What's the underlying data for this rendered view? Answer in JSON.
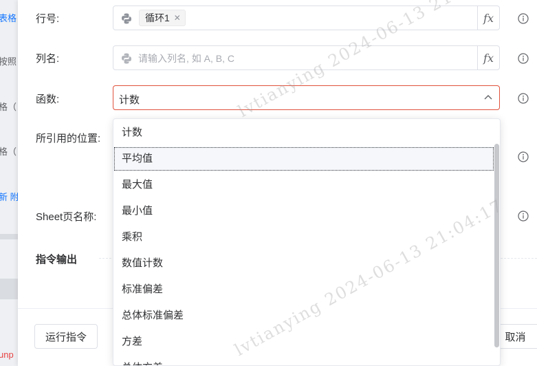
{
  "background_strip": {
    "fragments": [
      "表格",
      "按照",
      "格（",
      "格（",
      "新 附",
      "unp"
    ]
  },
  "form": {
    "row_label": "行号:",
    "row_tag": "循环1",
    "col_label": "列名:",
    "col_placeholder": "请输入列名, 如 A, B, C",
    "func_label": "函数:",
    "func_value": "计数",
    "ref_label": "所引用的位置:",
    "sheet_label": "Sheet页名称:",
    "fx_label": "fx"
  },
  "output_section": {
    "title": "指令输出"
  },
  "footer": {
    "run_button": "运行指令",
    "cancel_button": "取消"
  },
  "dropdown": {
    "options": [
      "计数",
      "平均值",
      "最大值",
      "最小值",
      "乘积",
      "数值计数",
      "标准偏差",
      "总体标准偏差",
      "方差",
      "总体方差"
    ],
    "highlighted_index": 1
  },
  "watermarks": [
    "lvtianying 2024-06-13 21:",
    "lvtianying 2024-06-13 21:04:17"
  ],
  "colors": {
    "error_border": "#e0503b",
    "link_blue": "#1677ff",
    "placeholder": "#a8abb2"
  },
  "icons": [
    "python-icon",
    "fx-icon",
    "chevron-up-icon",
    "info-icon",
    "close-icon"
  ]
}
